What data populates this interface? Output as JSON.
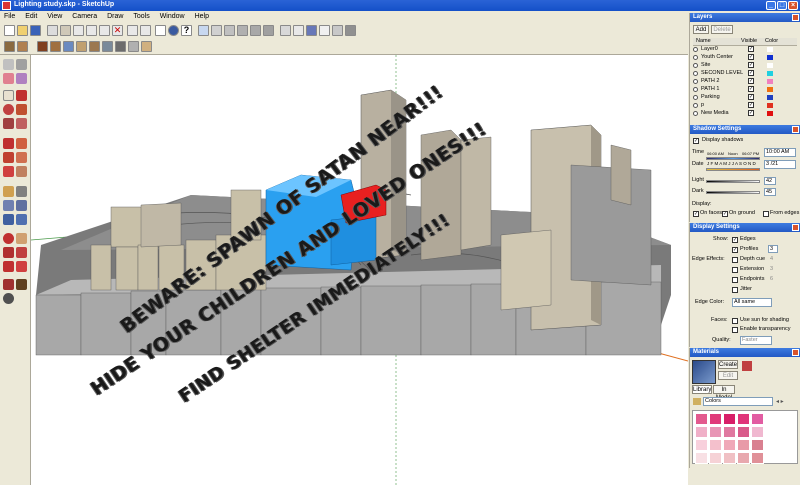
{
  "window": {
    "title": "Lighting study.skp - SketchUp"
  },
  "menu": [
    "File",
    "Edit",
    "View",
    "Camera",
    "Draw",
    "Tools",
    "Window",
    "Help"
  ],
  "viewport": {
    "messages": [
      "BEWARE: SPAWN OF SATAN NEAR!!!",
      "HIDE YOUR CHILDREN AND LOVED ONES!!!",
      "FIND SHELTER IMMEDIATELY!!!"
    ]
  },
  "layers": {
    "title": "Layers",
    "add_label": "Add",
    "delete_label": "Delete",
    "columns": [
      "Name",
      "Visible",
      "Color"
    ],
    "rows": [
      {
        "name": "Layer0",
        "visible": true,
        "color": "#ffffff"
      },
      {
        "name": "Youth Center",
        "visible": true,
        "color": "#1030d0"
      },
      {
        "name": "Site",
        "visible": true,
        "color": "#ffffff"
      },
      {
        "name": "SECOND LEVEL",
        "visible": true,
        "color": "#20d0e0"
      },
      {
        "name": "PATH 2",
        "visible": true,
        "color": "#f080c0"
      },
      {
        "name": "PATH 1",
        "visible": true,
        "color": "#f07010"
      },
      {
        "name": "Parking",
        "visible": true,
        "color": "#2040c0"
      },
      {
        "name": "p",
        "visible": true,
        "color": "#e03020"
      },
      {
        "name": "New Media",
        "visible": true,
        "color": "#e01010"
      }
    ]
  },
  "shadow": {
    "title": "Shadow Settings",
    "display_shadows": "Display shadows",
    "time_label": "Time",
    "time_start": "06:00 AM",
    "noon": "Noon",
    "time_end": "06:07 PM",
    "time_value": "10:00 AM",
    "date_label": "Date",
    "months": "J F M A M J J A S O N D",
    "date_value": "3 /21",
    "light_label": "Light",
    "light_value": "42",
    "dark_label": "Dark",
    "dark_value": "45",
    "display_label": "Display:",
    "on_faces": "On faces",
    "on_ground": "On ground",
    "from_edges": "From edges"
  },
  "display": {
    "title": "Display Settings",
    "show_label": "Show:",
    "edges": "Edges",
    "profiles": "Profiles",
    "profiles_value": "3",
    "edge_effects_label": "Edge Effects:",
    "depth_cue": "Depth cue",
    "depth_value": "4",
    "extension": "Extension",
    "extension_value": "3",
    "endpoints": "Endpoints",
    "endpoints_value": "6",
    "jitter": "Jitter",
    "edge_color_label": "Edge Color:",
    "edge_color_value": "All same",
    "faces_label": "Faces:",
    "use_sun": "Use sun for shading",
    "enable_transparency": "Enable transparency",
    "quality_label": "Quality:",
    "quality_value": "Faster"
  },
  "materials": {
    "title": "Materials",
    "create": "Create",
    "edit": "Edit",
    "tab_library": "Library",
    "tab_in_model": "In Model",
    "library_value": "Colors",
    "swatches": [
      "#e35a8e",
      "#e03a7a",
      "#d81e68",
      "#e0357a",
      "#e25ca2",
      "#f0b0c8",
      "#e895b5",
      "#e078a0",
      "#d95a8a",
      "#f0b8d0",
      "#f8d0dc",
      "#f4c0cc",
      "#f0a8b8",
      "#e89aa8",
      "#d98090",
      "#f8e0e4",
      "#f6d2d6",
      "#f0c0c4",
      "#e8a8ae",
      "#e09098"
    ]
  }
}
